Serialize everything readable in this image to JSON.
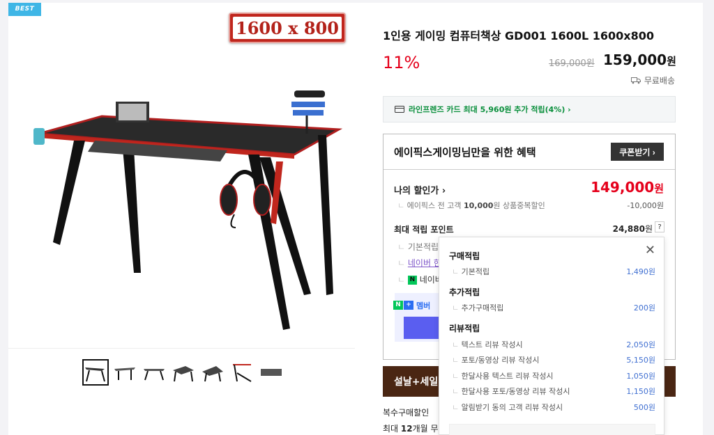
{
  "gallery": {
    "badge": "BEST",
    "size_tag": "1600 x 800"
  },
  "product": {
    "title": "1인용 게이밍 컴퓨터책상 GD001 1600L 1600x800",
    "discount": "11%",
    "original_price": "169,000원",
    "sale_price": "159,000",
    "price_unit": "원",
    "shipping": "무료배송"
  },
  "card_benefit": "라인프렌즈 카드 최대 5,960원 추가 적립(4%) ›",
  "benefit": {
    "heading": "에이픽스게이밍님만을 위한 혜택",
    "coupon_button": "쿠폰받기 ›",
    "my_price_label": "나의 할인가 ›",
    "my_price": "149,000",
    "my_price_unit": "원",
    "coupon_desc_prefix": "에이픽스 전 고객 ",
    "coupon_desc_amount": "10,000",
    "coupon_desc_suffix": "원 상품중복할인",
    "coupon_value": "-10,000원",
    "max_point_label": "최대 적립 포인트",
    "max_point": "24,880",
    "max_point_unit": "원",
    "help": "?",
    "base_point": "기본적립",
    "naver_link": "네이버 한",
    "naver_pay": "네이버",
    "naver_n": "N",
    "membership": "멤버",
    "np_n": "N",
    "np_plus": "+"
  },
  "promo": {
    "banner": "설날+세일"
  },
  "bottom": {
    "line1": "복수구매할인",
    "line2_prefix": "최대 ",
    "line2_bold": "12",
    "line2_suffix": "개월 무"
  },
  "popup": {
    "close": "✕",
    "sections": [
      {
        "title": "구매적립",
        "rows": [
          {
            "label": "기본적립",
            "value": "1,490원"
          }
        ]
      },
      {
        "title": "추가적립",
        "rows": [
          {
            "label": "추가구매적립",
            "value": "200원"
          }
        ]
      },
      {
        "title": "리뷰적립",
        "rows": [
          {
            "label": "텍스트 리뷰 작성시",
            "value": "2,050원"
          },
          {
            "label": "포토/동영상 리뷰 작성시",
            "value": "5,150원"
          },
          {
            "label": "한달사용 텍스트 리뷰 작성시",
            "value": "1,050원"
          },
          {
            "label": "한달사용 포토/동영상 리뷰 작성시",
            "value": "1,150원"
          },
          {
            "label": "알림받기 동의 고객 리뷰 작성시",
            "value": "500원"
          }
        ]
      }
    ]
  },
  "colors": {
    "accent_red": "#e5001b",
    "naver_green": "#03c75a",
    "link_blue": "#3f6fd1",
    "promo_brown": "#4a2613",
    "best_blue": "#3fb6e6"
  },
  "icons": [
    "truck-icon",
    "card-icon",
    "close-icon",
    "naver-pay-icon"
  ]
}
